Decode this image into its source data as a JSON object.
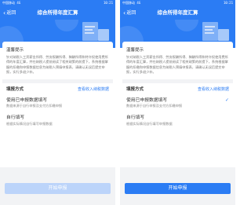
{
  "panels": [
    {
      "status_left": "中国移动 4G",
      "status_right": "10:21",
      "back_label": "返回",
      "title": "综合所得年度汇算",
      "tip_title": "温馨提示",
      "tip_text": "针对纳税人工资薪金所得、劳务报酬所得、稿酬所得和特许权使用费所得的年度汇算，并在纳税人提前阅读了相关政策的前提下，系统根据掌握的扣缴和申报数据信息为纳税人预填申报表，请确认无误后提交申报，实行多退少补。",
      "mode_label": "填报方式",
      "mode_link": "查看收入纳税数据",
      "option1_title": "使用已申报数据填写",
      "option1_sub": "数据来源于自行申报及支付方扣缴申报",
      "option2_title": "自行填写",
      "option2_sub": "根据实际情况自行填写申报数据",
      "option1_checked": false,
      "button_label": "开始申报",
      "button_enabled": false
    },
    {
      "status_left": "中国移动 4G",
      "status_right": "10:21",
      "back_label": "返回",
      "title": "综合所得年度汇算",
      "tip_title": "温馨提示",
      "tip_text": "针对纳税人工资薪金所得、劳务报酬所得、稿酬所得和特许权使用费所得的年度汇算，并在纳税人提前阅读了相关政策的前提下，系统根据掌握的扣缴和申报数据信息为纳税人预填申报表，请确认无误后提交申报，实行多退少补。",
      "mode_label": "填报方式",
      "mode_link": "查看收入纳税数据",
      "option1_title": "使用已申报数据填写",
      "option1_sub": "数据来源于自行申报及支付方扣缴申报",
      "option2_title": "自行填写",
      "option2_sub": "根据实际情况自行填写申报数据",
      "option1_checked": true,
      "check_icon": "check-icon",
      "button_label": "开始申报",
      "button_enabled": true
    }
  ],
  "colors": {
    "primary": "#2b7cf4",
    "disabled": "#bcd4fa",
    "background": "#f2f3f5"
  }
}
